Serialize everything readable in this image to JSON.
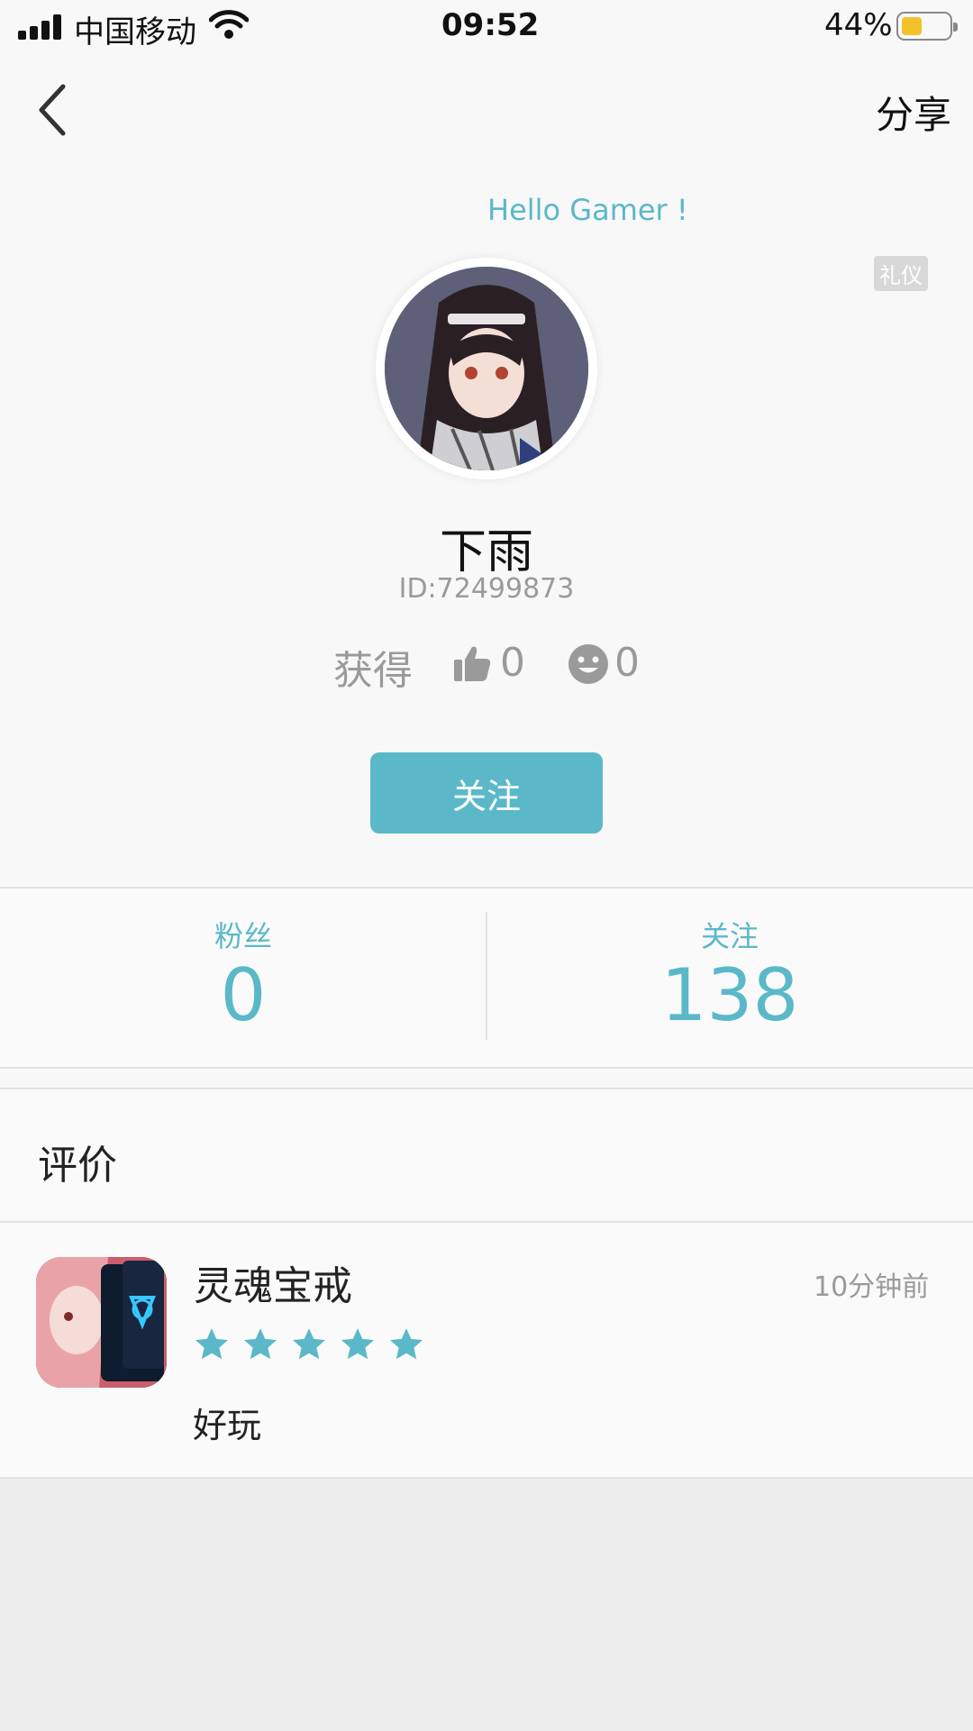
{
  "status_bar": {
    "carrier": "中国移动",
    "time": "09:52",
    "battery": "44%"
  },
  "nav": {
    "share_label": "分享"
  },
  "profile": {
    "greeting": "Hello Gamer !",
    "etiquette_badge": "礼仪",
    "username": "下雨",
    "id_text": "ID:72499873",
    "earned_label": "获得",
    "likes_count": "0",
    "smiles_count": "0",
    "follow_button": "关注"
  },
  "stats": {
    "fans_label": "粉丝",
    "fans_value": "0",
    "following_label": "关注",
    "following_value": "138"
  },
  "reviews": {
    "title": "评价",
    "items": [
      {
        "game": "灵魂宝戒",
        "time": "10分钟前",
        "rating": 5,
        "comment": "好玩"
      }
    ]
  },
  "colors": {
    "accent": "#5bb8c9",
    "battery": "#f3c22b"
  }
}
